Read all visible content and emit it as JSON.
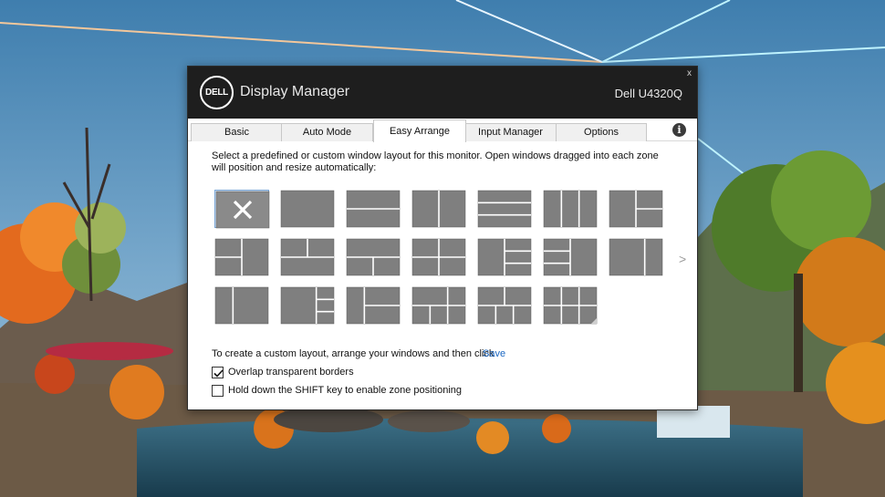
{
  "app": {
    "logo_text": "DELL",
    "title": "Display Manager",
    "monitor": "Dell U4320Q",
    "close_glyph": "x"
  },
  "tabs": [
    {
      "label": "Basic",
      "active": false
    },
    {
      "label": "Auto Mode",
      "active": false
    },
    {
      "label": "Easy Arrange",
      "active": true
    },
    {
      "label": "Input Manager",
      "active": false
    },
    {
      "label": "Options",
      "active": false
    }
  ],
  "info_icon": {
    "glyph": "i",
    "icon": "info-icon"
  },
  "description": "Select a predefined or custom window layout for this monitor.  Open windows dragged into each zone will position and resize automatically:",
  "layout_grid": {
    "selected_index": 0,
    "layout_count": 20,
    "layout_names": [
      "none",
      "full",
      "top-bottom",
      "left-right",
      "three-rows",
      "three-columns",
      "left-half-right-split",
      "left-split-right-half",
      "top-split-bottom-half",
      "top-half-bottom-split",
      "four-quadrants",
      "left-half-right-three-rows",
      "left-three-rows-right-half",
      "left-wide-right-narrow",
      "left-narrow-right-wide",
      "left-wide-right-split",
      "left-narrow-right-split",
      "wide-grid",
      "split-grid",
      "six-grid"
    ],
    "next_glyph": ">"
  },
  "custom": {
    "text": "To create a custom layout, arrange your windows and then click",
    "save_label": "Save"
  },
  "options": [
    {
      "label": "Overlap transparent borders",
      "checked": true
    },
    {
      "label": "Hold down the SHIFT key to enable zone positioning",
      "checked": false
    }
  ],
  "colors": {
    "titlebar": "#1e1e1e",
    "tile": "#7f7f7f",
    "selected_bg": "#d7e6f6",
    "selected_border": "#7aa7d8",
    "link": "#1a66c2"
  }
}
